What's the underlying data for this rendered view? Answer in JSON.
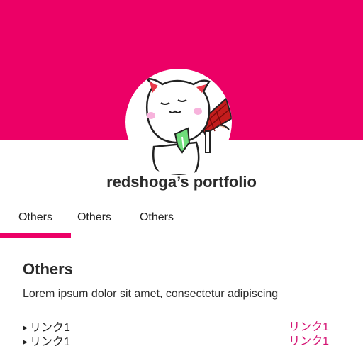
{
  "header": {
    "title": "redshoga’s portfolio",
    "brand_color": "#ec0066",
    "avatar_icon": "white-cat-avatar"
  },
  "tabs": [
    {
      "label": "Others",
      "active": true
    },
    {
      "label": "Others",
      "active": false
    },
    {
      "label": "Others",
      "active": false
    }
  ],
  "main": {
    "section_title": "Others",
    "description": "Lorem ipsum dolor sit amet, consectetur adipiscing",
    "bullet_icon": "triangle-right-icon",
    "links": [
      {
        "label": "リンク1",
        "link_label": "リンク1"
      },
      {
        "label": "リンク1",
        "link_label": "リンク1"
      }
    ],
    "link_color": "#d41373"
  }
}
